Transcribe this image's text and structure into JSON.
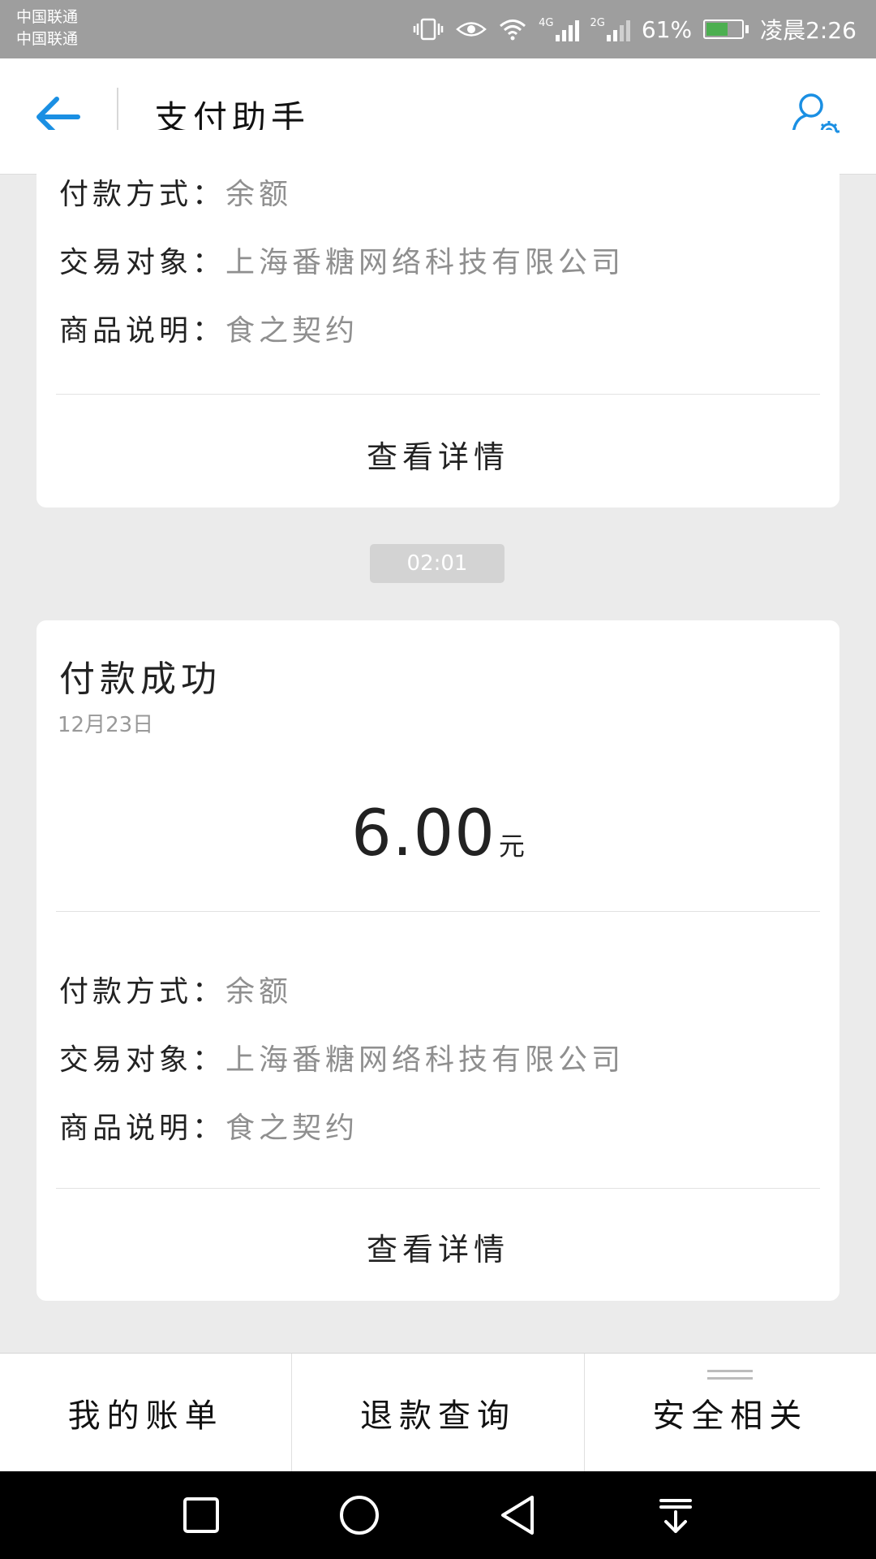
{
  "status_bar": {
    "carrier_1": "中国联通",
    "carrier_2": "中国联通",
    "network_1": "4G",
    "network_2": "2G",
    "battery_percent": "61%",
    "battery_level": 0.61,
    "time": "凌晨2:26",
    "icons": [
      "vibrate-icon",
      "eye-icon",
      "wifi-icon",
      "signal-icon",
      "battery-icon"
    ]
  },
  "header": {
    "title": "支付助手",
    "back_icon": "back-arrow-icon",
    "settings_icon": "user-settings-icon",
    "accent_color": "#1a8fe3"
  },
  "top_card": {
    "rows": [
      {
        "label": "付款方式：",
        "value": "余额"
      },
      {
        "label": "交易对象：",
        "value": "上海番糖网络科技有限公司"
      },
      {
        "label": "商品说明：",
        "value": "食之契约"
      }
    ],
    "detail_link": "查看详情"
  },
  "time_badge": "02:01",
  "main_card": {
    "title": "付款成功",
    "date": "12月23日",
    "amount": "6.00",
    "unit": "元",
    "rows": [
      {
        "label": "付款方式：",
        "value": "余额"
      },
      {
        "label": "交易对象：",
        "value": "上海番糖网络科技有限公司"
      },
      {
        "label": "商品说明：",
        "value": "食之契约"
      }
    ],
    "detail_link": "查看详情"
  },
  "bottom_tabs": [
    {
      "label": "我的账单"
    },
    {
      "label": "退款查询"
    },
    {
      "label": "安全相关"
    }
  ],
  "nav_bar": {
    "icons": [
      "recent-apps-icon",
      "home-icon",
      "back-icon",
      "notification-pull-icon"
    ]
  }
}
